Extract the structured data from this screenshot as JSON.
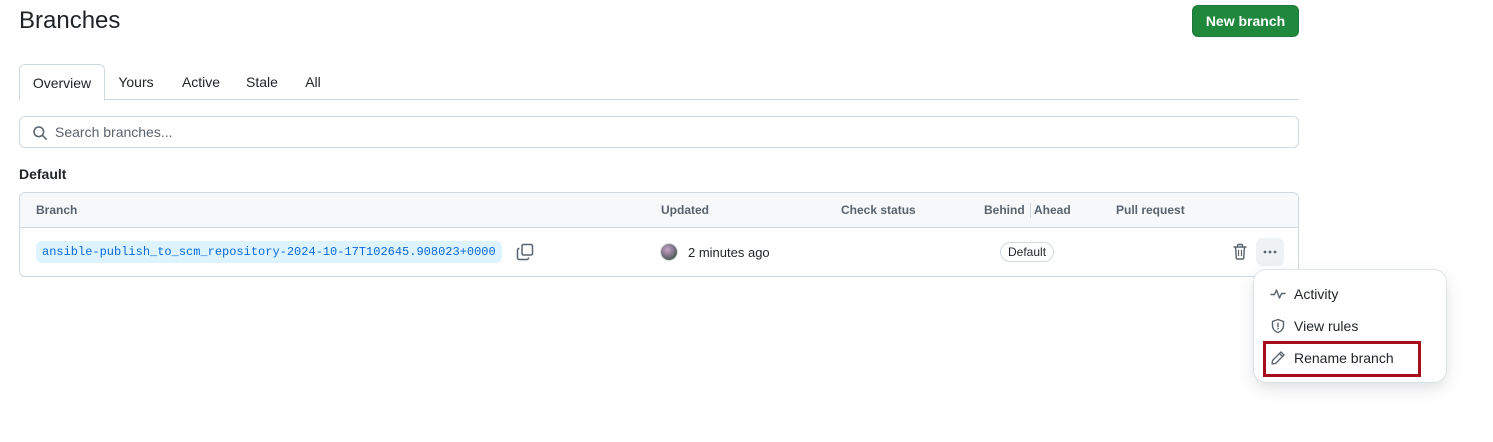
{
  "header": {
    "title": "Branches",
    "new_branch_label": "New branch"
  },
  "tabs": [
    {
      "label": "Overview",
      "selected": true
    },
    {
      "label": "Yours",
      "selected": false
    },
    {
      "label": "Active",
      "selected": false
    },
    {
      "label": "Stale",
      "selected": false
    },
    {
      "label": "All",
      "selected": false
    }
  ],
  "search": {
    "placeholder": "Search branches...",
    "value": ""
  },
  "default_section": {
    "title": "Default",
    "columns": {
      "branch": "Branch",
      "updated": "Updated",
      "check_status": "Check status",
      "behind": "Behind",
      "ahead": "Ahead",
      "pull_request": "Pull request"
    },
    "rows": [
      {
        "branch": "ansible-publish_to_scm_repository-2024-10-17T102645.908023+0000",
        "updated": "2 minutes ago",
        "badge": "Default"
      }
    ]
  },
  "menu": {
    "items": [
      {
        "label": "Activity",
        "icon": "pulse-icon"
      },
      {
        "label": "View rules",
        "icon": "shield-icon"
      },
      {
        "label": "Rename branch",
        "icon": "pencil-icon",
        "highlighted": true
      }
    ]
  },
  "colors": {
    "primary_button": "#1f883d",
    "branch_link": "#0969da",
    "branch_bg": "#ddf4ff",
    "highlight_border": "#a50e1a"
  }
}
